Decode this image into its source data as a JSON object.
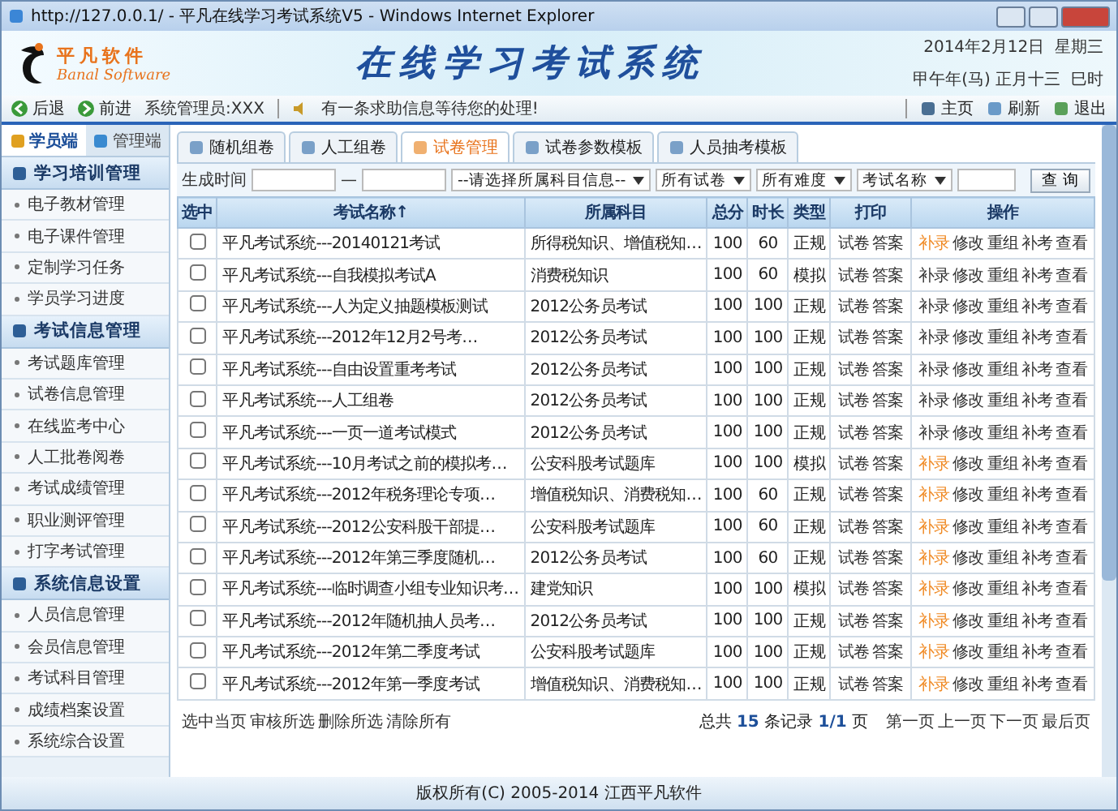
{
  "window": {
    "title": "http://127.0.0.1/ - 平凡在线学习考试系统V5 - Windows Internet Explorer"
  },
  "header": {
    "logo_name": "平凡软件",
    "logo_subtitle": "Banal Software",
    "system_title": "在线学习考试系统",
    "date": "2014年2月12日  星期三",
    "lunar_date": "甲午年(马) 正月十三  巳时"
  },
  "navbar": {
    "back": "后退",
    "forward": "前进",
    "user": "系统管理员:XXX",
    "message": "有一条求助信息等待您的处理!",
    "home": "主页",
    "refresh": "刷新",
    "logout": "退出"
  },
  "sidebar": {
    "tabs": [
      {
        "label": "学员端",
        "selected": true
      },
      {
        "label": "管理端",
        "selected": false
      }
    ],
    "groups": [
      {
        "title": "学习培训管理",
        "items": [
          "电子教材管理",
          "电子课件管理",
          "定制学习任务",
          "学员学习进度"
        ]
      },
      {
        "title": "考试信息管理",
        "items": [
          "考试题库管理",
          "试卷信息管理",
          "在线监考中心",
          "人工批卷阅卷",
          "考试成绩管理",
          "职业测评管理",
          "打字考试管理"
        ]
      },
      {
        "title": "系统信息设置",
        "items": [
          "人员信息管理",
          "会员信息管理",
          "考试科目管理",
          "成绩档案设置",
          "系统综合设置"
        ]
      }
    ]
  },
  "tabs": [
    {
      "label": "随机组卷",
      "selected": false
    },
    {
      "label": "人工组卷",
      "selected": false
    },
    {
      "label": "试卷管理",
      "selected": true
    },
    {
      "label": "试卷参数模板",
      "selected": false
    },
    {
      "label": "人员抽考模板",
      "selected": false
    }
  ],
  "filters": {
    "time_label": "生成时间",
    "separator": "—",
    "subject": "--请选择所属科目信息--",
    "paper": "所有试卷",
    "difficulty": "所有难度",
    "field": "考试名称",
    "search_button": "查 询"
  },
  "table": {
    "columns": [
      "选中",
      "考试名称↑",
      "所属科目",
      "总分",
      "时长",
      "类型",
      "打印",
      "操作"
    ],
    "rows": [
      {
        "checked": false,
        "name": "平凡考试系统---20140121考试",
        "subject": "所得税知识、增值税知…",
        "score": "100",
        "duration": "60",
        "type": "正规",
        "print": [
          "试卷",
          "答案"
        ],
        "actions": [
          "补录",
          "修改",
          "重组",
          "补考",
          "查看"
        ],
        "first_action_highlighted": true
      },
      {
        "checked": false,
        "name": "平凡考试系统---自我模拟考试A",
        "subject": "消费税知识",
        "score": "100",
        "duration": "60",
        "type": "模拟",
        "print": [
          "试卷",
          "答案"
        ],
        "actions": [
          "补录",
          "修改",
          "重组",
          "补考",
          "查看"
        ],
        "first_action_highlighted": false
      },
      {
        "checked": false,
        "name": "平凡考试系统---人为定义抽题模板测试",
        "subject": "2012公务员考试",
        "score": "100",
        "duration": "100",
        "type": "正规",
        "print": [
          "试卷",
          "答案"
        ],
        "actions": [
          "补录",
          "修改",
          "重组",
          "补考",
          "查看"
        ],
        "first_action_highlighted": false
      },
      {
        "checked": false,
        "name": "平凡考试系统---2012年12月2号考…",
        "subject": "2012公务员考试",
        "score": "100",
        "duration": "100",
        "type": "正规",
        "print": [
          "试卷",
          "答案"
        ],
        "actions": [
          "补录",
          "修改",
          "重组",
          "补考",
          "查看"
        ],
        "first_action_highlighted": false
      },
      {
        "checked": false,
        "name": "平凡考试系统---自由设置重考考试",
        "subject": "2012公务员考试",
        "score": "100",
        "duration": "100",
        "type": "正规",
        "print": [
          "试卷",
          "答案"
        ],
        "actions": [
          "补录",
          "修改",
          "重组",
          "补考",
          "查看"
        ],
        "first_action_highlighted": false
      },
      {
        "checked": false,
        "name": "平凡考试系统---人工组卷",
        "subject": "2012公务员考试",
        "score": "100",
        "duration": "100",
        "type": "正规",
        "print": [
          "试卷",
          "答案"
        ],
        "actions": [
          "补录",
          "修改",
          "重组",
          "补考",
          "查看"
        ],
        "first_action_highlighted": false
      },
      {
        "checked": false,
        "name": "平凡考试系统---一页一道考试模式",
        "subject": "2012公务员考试",
        "score": "100",
        "duration": "100",
        "type": "正规",
        "print": [
          "试卷",
          "答案"
        ],
        "actions": [
          "补录",
          "修改",
          "重组",
          "补考",
          "查看"
        ],
        "first_action_highlighted": false
      },
      {
        "checked": false,
        "name": "平凡考试系统---10月考试之前的模拟考…",
        "subject": "公安科股考试题库",
        "score": "100",
        "duration": "100",
        "type": "模拟",
        "print": [
          "试卷",
          "答案"
        ],
        "actions": [
          "补录",
          "修改",
          "重组",
          "补考",
          "查看"
        ],
        "first_action_highlighted": true
      },
      {
        "checked": false,
        "name": "平凡考试系统---2012年税务理论专项…",
        "subject": "增值税知识、消费税知…",
        "score": "100",
        "duration": "60",
        "type": "正规",
        "print": [
          "试卷",
          "答案"
        ],
        "actions": [
          "补录",
          "修改",
          "重组",
          "补考",
          "查看"
        ],
        "first_action_highlighted": true
      },
      {
        "checked": false,
        "name": "平凡考试系统---2012公安科股干部提…",
        "subject": "公安科股考试题库",
        "score": "100",
        "duration": "60",
        "type": "正规",
        "print": [
          "试卷",
          "答案"
        ],
        "actions": [
          "补录",
          "修改",
          "重组",
          "补考",
          "查看"
        ],
        "first_action_highlighted": true
      },
      {
        "checked": false,
        "name": "平凡考试系统---2012年第三季度随机…",
        "subject": "2012公务员考试",
        "score": "100",
        "duration": "60",
        "type": "正规",
        "print": [
          "试卷",
          "答案"
        ],
        "actions": [
          "补录",
          "修改",
          "重组",
          "补考",
          "查看"
        ],
        "first_action_highlighted": true
      },
      {
        "checked": false,
        "name": "平凡考试系统---临时调查小组专业知识考…",
        "subject": "建党知识",
        "score": "100",
        "duration": "100",
        "type": "模拟",
        "print": [
          "试卷",
          "答案"
        ],
        "actions": [
          "补录",
          "修改",
          "重组",
          "补考",
          "查看"
        ],
        "first_action_highlighted": true
      },
      {
        "checked": false,
        "name": "平凡考试系统---2012年随机抽人员考…",
        "subject": "2012公务员考试",
        "score": "100",
        "duration": "100",
        "type": "正规",
        "print": [
          "试卷",
          "答案"
        ],
        "actions": [
          "补录",
          "修改",
          "重组",
          "补考",
          "查看"
        ],
        "first_action_highlighted": true
      },
      {
        "checked": false,
        "name": "平凡考试系统---2012年第二季度考试",
        "subject": "公安科股考试题库",
        "score": "100",
        "duration": "100",
        "type": "正规",
        "print": [
          "试卷",
          "答案"
        ],
        "actions": [
          "补录",
          "修改",
          "重组",
          "补考",
          "查看"
        ],
        "first_action_highlighted": true
      },
      {
        "checked": false,
        "name": "平凡考试系统---2012年第一季度考试",
        "subject": "增值税知识、消费税知…",
        "score": "100",
        "duration": "100",
        "type": "正规",
        "print": [
          "试卷",
          "答案"
        ],
        "actions": [
          "补录",
          "修改",
          "重组",
          "补考",
          "查看"
        ],
        "first_action_highlighted": true
      }
    ]
  },
  "bulk_actions": [
    "选中当页",
    "审核所选",
    "删除所选",
    "清除所有"
  ],
  "pagination": {
    "summary": "总共 **15** 条记录 **1/1** 页",
    "links": [
      "第一页",
      "上一页",
      "下一页",
      "最后页"
    ]
  },
  "footer": "版权所有(C) 2005-2014 江西平凡软件"
}
